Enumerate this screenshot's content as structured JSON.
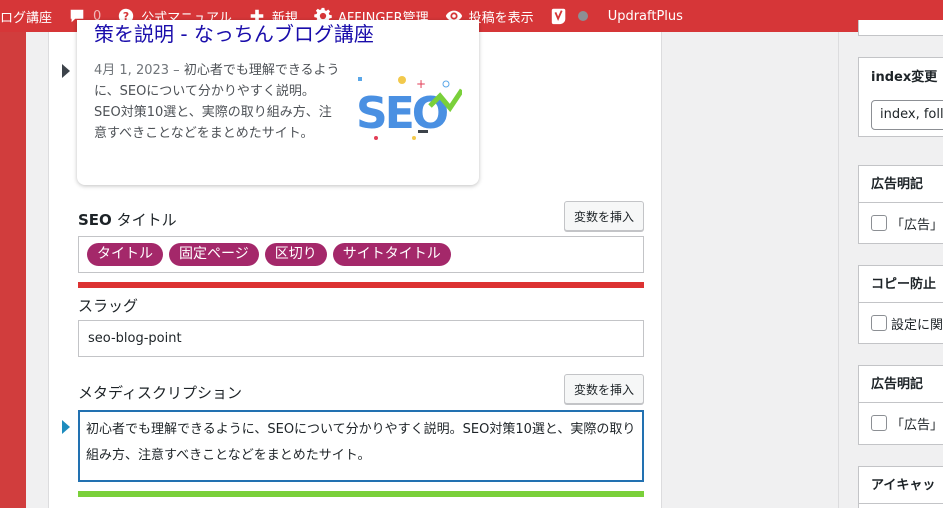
{
  "admin_bar": {
    "site_title": "ログ講座",
    "comments_count": "0",
    "manual": "公式マニュアル",
    "new": "新規",
    "affinger": "AFFINGER管理",
    "view_post": "投稿を表示",
    "updraft": "UpdraftPlus",
    "color": "#d63638"
  },
  "preview": {
    "title": "策を説明 - なっちんブログ講座",
    "date": "4月 1, 2023",
    "separator": "–",
    "description": "初心者でも理解できるように、SEOについて分かりやすく説明。SEO対策10選と、実際の取り組み方、注意すべきことなどをまとめたサイト。",
    "thumbnail_text": "SEO"
  },
  "seo_title": {
    "label_strong": "SEO",
    "label_rest": " タイトル",
    "insert_button": "変数を挿入",
    "pills": [
      "タイトル",
      "固定ページ",
      "区切り",
      "サイトタイトル"
    ],
    "progress_color": "#dc3232",
    "progress": 1.0
  },
  "slug": {
    "label": "スラッグ",
    "value": "seo-blog-point"
  },
  "meta_description": {
    "label": "メタディスクリプション",
    "insert_button": "変数を挿入",
    "value": "初心者でも理解できるように、SEOについて分かりやすく説明。SEO対策10選と、実際の取り組み方、注意すべきことなどをまとめたサイト。",
    "progress_color": "#7ad03a",
    "progress": 1.0
  },
  "sidebar": {
    "index_box": {
      "title": "index変更",
      "value": "index, follo"
    },
    "ad_box_1": {
      "title": "広告明記",
      "checkbox_label": "「広告」"
    },
    "copy_box": {
      "title": "コピー防止",
      "checkbox_label": "設定に関"
    },
    "ad_box_2": {
      "title": "広告明記",
      "checkbox_label": "「広告」"
    },
    "eyecatch_box": {
      "title": "アイキャッ"
    }
  }
}
